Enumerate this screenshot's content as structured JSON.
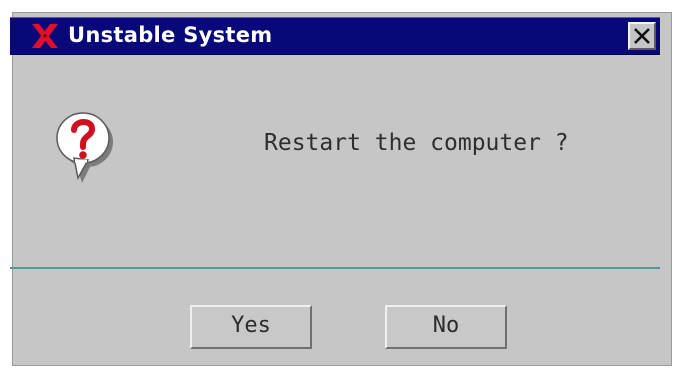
{
  "window": {
    "title": "Unstable System",
    "logo_icon": "x-logo-icon",
    "close_icon": "close-icon"
  },
  "dialog": {
    "icon": "question-icon",
    "message": "Restart the computer ?"
  },
  "buttons": {
    "yes_label": "Yes",
    "no_label": "No"
  },
  "colors": {
    "titlebar": "#08087a",
    "dialog_bg": "#c6c6c6",
    "logo_red": "#e0102a",
    "separator": "#4f9c96"
  }
}
